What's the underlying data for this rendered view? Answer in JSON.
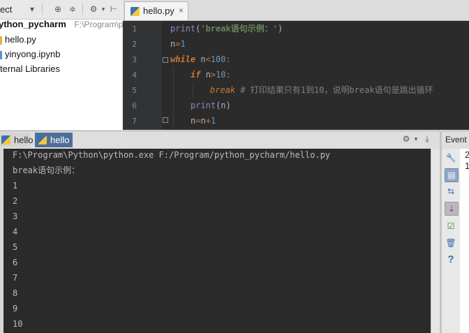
{
  "project_pane": {
    "toolbar_label": "ect",
    "tree": {
      "root_name": "ython_pycharm",
      "root_path": "F:\\Program\\p",
      "files": [
        {
          "name": "hello.py",
          "type": "python"
        },
        {
          "name": "yinyong.ipynb",
          "type": "notebook"
        }
      ],
      "external": "ternal Libraries"
    }
  },
  "editor": {
    "tab": {
      "label": "hello.py",
      "close": "×"
    },
    "line_numbers": [
      "1",
      "2",
      "3",
      "4",
      "5",
      "6",
      "7"
    ],
    "code": {
      "l1": {
        "fn": "print",
        "open": "(",
        "str": "'break语句示例：'",
        "close": ")"
      },
      "l2": {
        "var": "n",
        "op": "=",
        "num": "1"
      },
      "l3": {
        "kw": "while",
        "sp": " ",
        "var": "n",
        "op": "<",
        "num": "100",
        "colon": ":"
      },
      "l4": {
        "kw": "if",
        "sp": " ",
        "var": "n",
        "op": ">",
        "num": "10",
        "colon": ":"
      },
      "l5": {
        "kw": "break",
        "comment": " # 打印结果只有1到10，说明break语句是跳出循环"
      },
      "l6": {
        "fn": "print",
        "args": "(n)"
      },
      "l7": {
        "a": "n",
        "op1": "=",
        "b": "n",
        "op2": "+",
        "num": "1"
      }
    }
  },
  "run_pane": {
    "tabs": [
      {
        "label": "hello",
        "active": false
      },
      {
        "label": "hello",
        "active": true
      }
    ],
    "console_lines": [
      "F:\\Program\\Python\\python.exe F:/Program/python_pycharm/hello.py",
      "break语句示例：",
      "1",
      "2",
      "3",
      "4",
      "5",
      "6",
      "7",
      "8",
      "9",
      "10"
    ]
  },
  "event_log": {
    "title": "Event Log",
    "lines": [
      "2",
      "1"
    ]
  }
}
